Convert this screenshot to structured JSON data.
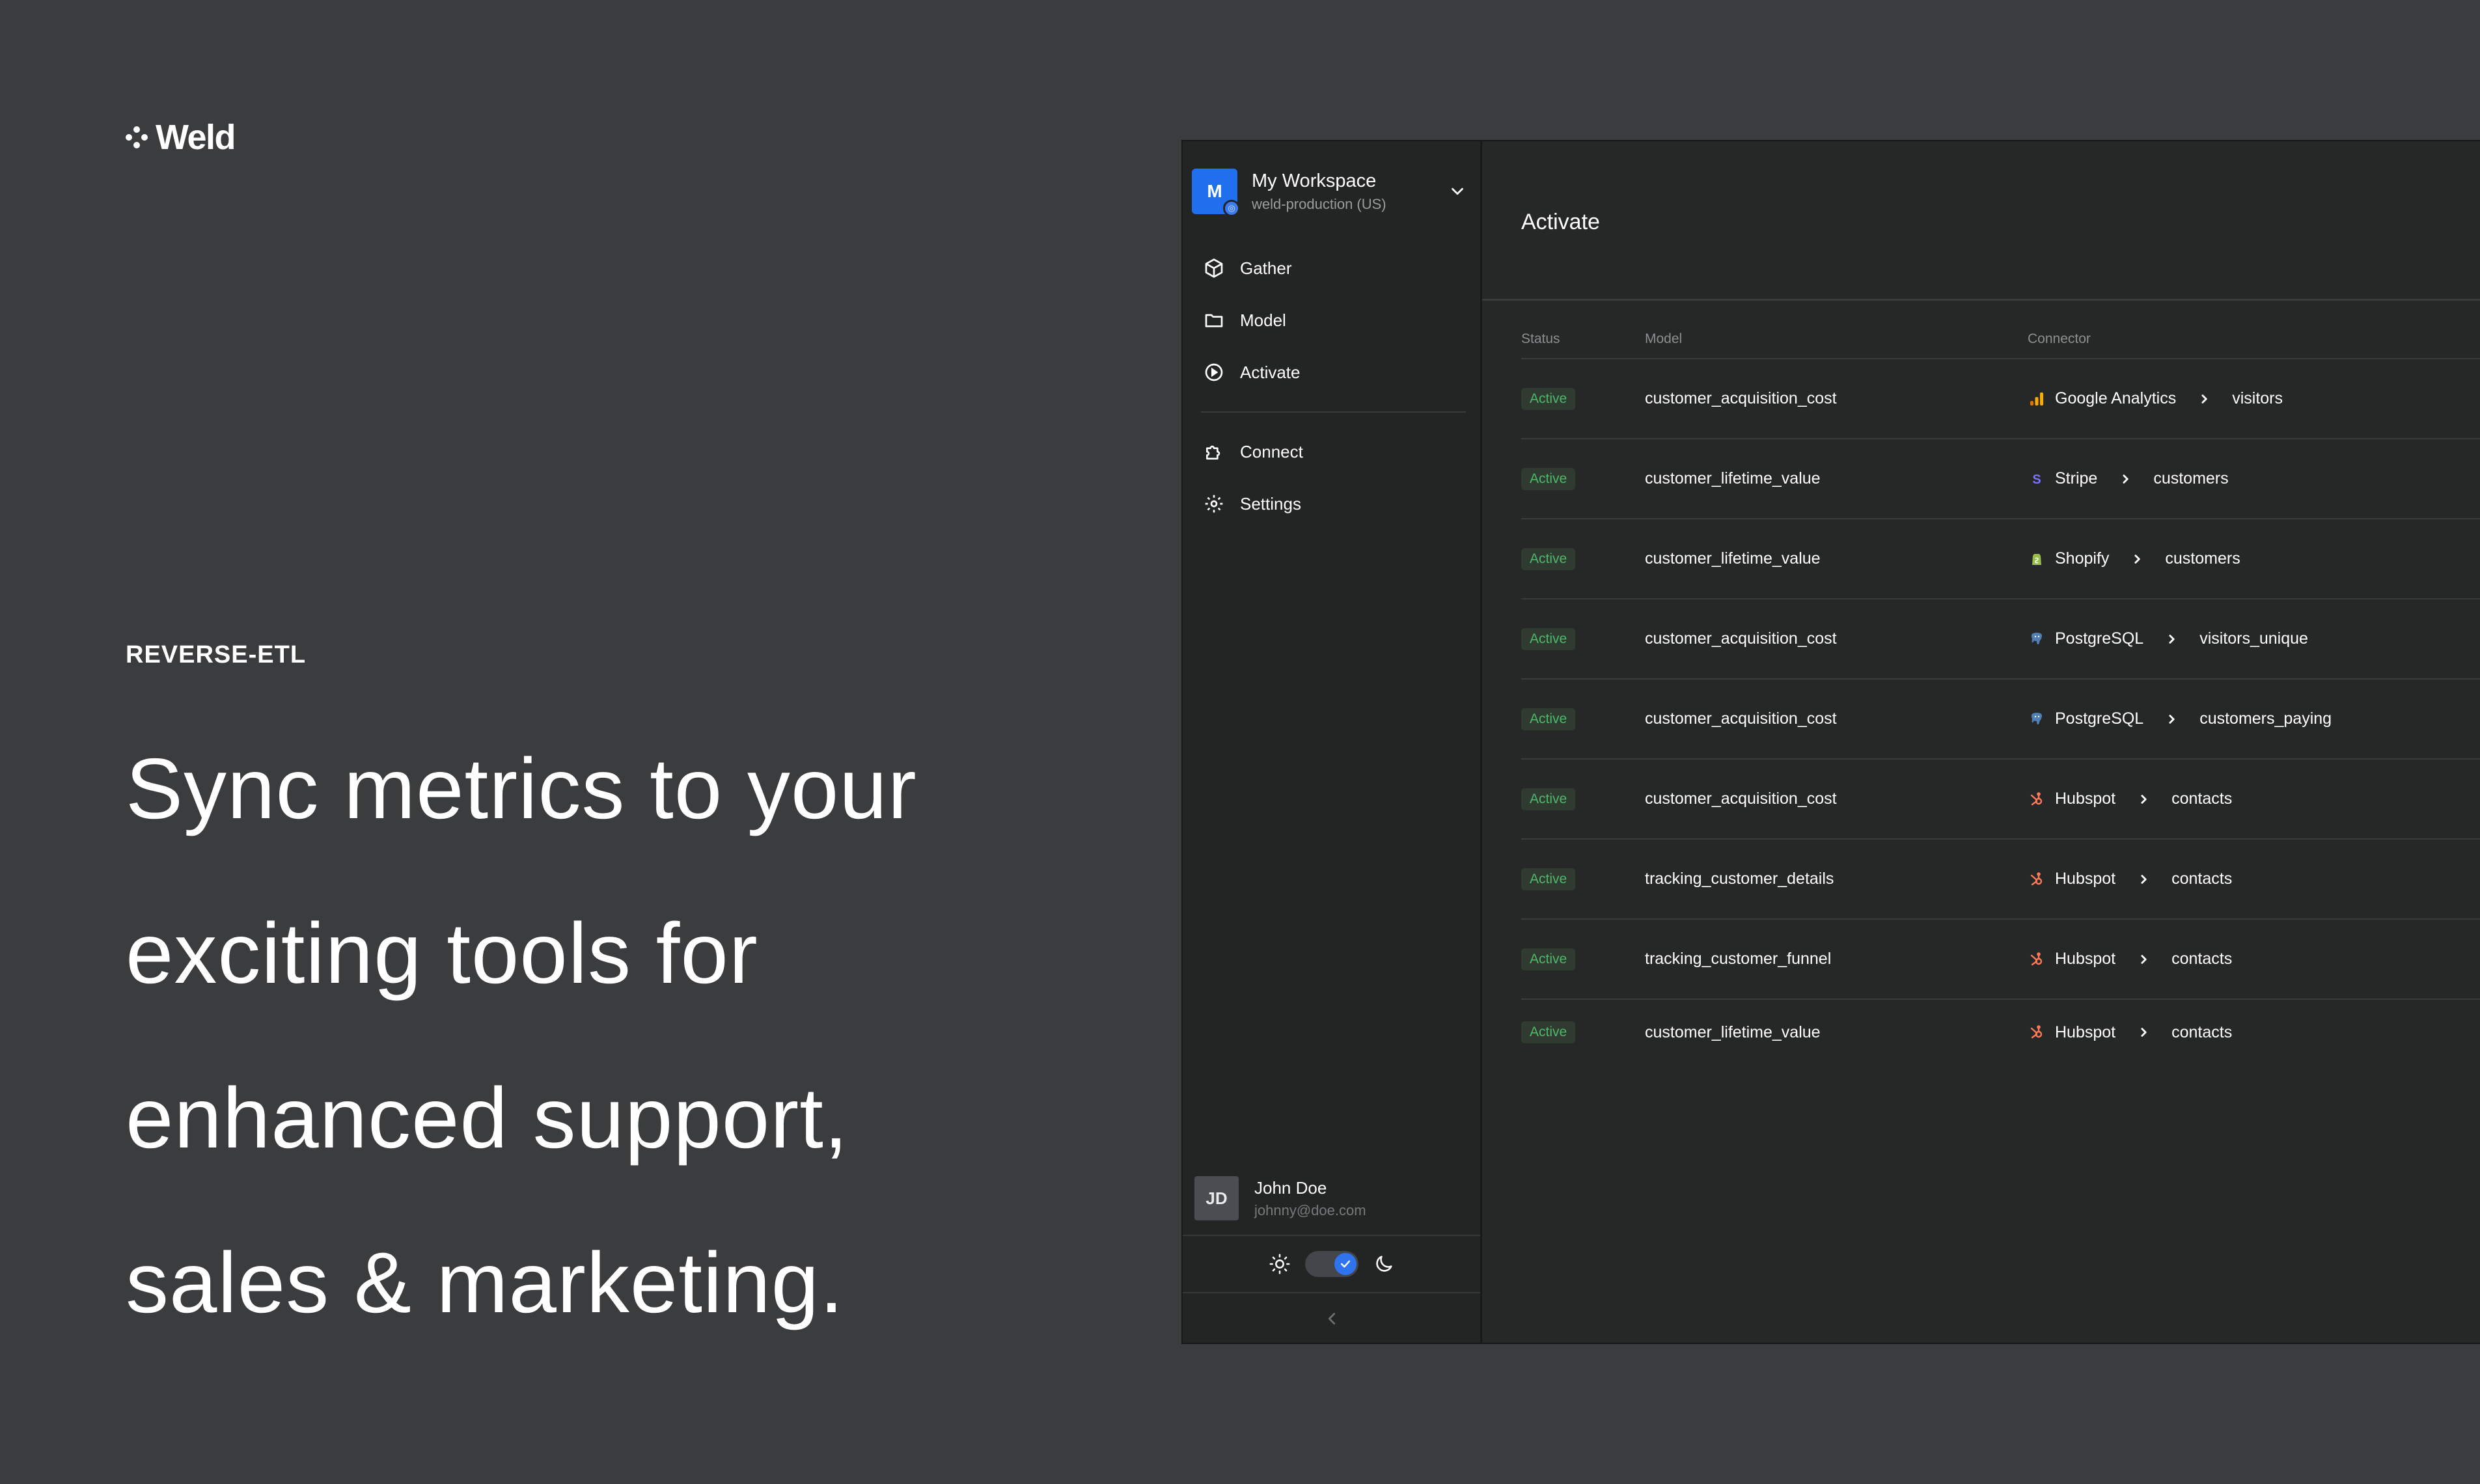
{
  "brand": {
    "name": "Weld"
  },
  "hero": {
    "eyebrow": "REVERSE-ETL",
    "headline_lines": [
      "Sync metrics to your",
      "exciting tools for",
      "enhanced support,",
      "sales & marketing."
    ]
  },
  "app": {
    "workspace": {
      "initial": "M",
      "name": "My Workspace",
      "subtitle": "weld-production (US)"
    },
    "nav": {
      "primary": [
        {
          "label": "Gather",
          "icon": "cube-icon"
        },
        {
          "label": "Model",
          "icon": "folder-icon"
        },
        {
          "label": "Activate",
          "icon": "play-circle-icon"
        }
      ],
      "secondary": [
        {
          "label": "Connect",
          "icon": "puzzle-icon"
        },
        {
          "label": "Settings",
          "icon": "gear-icon"
        }
      ]
    },
    "user": {
      "initials": "JD",
      "name": "John Doe",
      "email": "johnny@doe.com"
    },
    "theme": {
      "mode": "dark"
    },
    "main": {
      "title": "Activate",
      "columns": {
        "status": "Status",
        "model": "Model",
        "connector": "Connector"
      },
      "rows": [
        {
          "status": "Active",
          "model": "customer_acquisition_cost",
          "connector": "Google Analytics",
          "connector_icon": "google-analytics-icon",
          "target": "visitors"
        },
        {
          "status": "Active",
          "model": "customer_lifetime_value",
          "connector": "Stripe",
          "connector_icon": "stripe-icon",
          "target": "customers"
        },
        {
          "status": "Active",
          "model": "customer_lifetime_value",
          "connector": "Shopify",
          "connector_icon": "shopify-icon",
          "target": "customers"
        },
        {
          "status": "Active",
          "model": "customer_acquisition_cost",
          "connector": "PostgreSQL",
          "connector_icon": "postgresql-icon",
          "target": "visitors_unique"
        },
        {
          "status": "Active",
          "model": "customer_acquisition_cost",
          "connector": "PostgreSQL",
          "connector_icon": "postgresql-icon",
          "target": "customers_paying"
        },
        {
          "status": "Active",
          "model": "customer_acquisition_cost",
          "connector": "Hubspot",
          "connector_icon": "hubspot-icon",
          "target": "contacts"
        },
        {
          "status": "Active",
          "model": "tracking_customer_details",
          "connector": "Hubspot",
          "connector_icon": "hubspot-icon",
          "target": "contacts"
        },
        {
          "status": "Active",
          "model": "tracking_customer_funnel",
          "connector": "Hubspot",
          "connector_icon": "hubspot-icon",
          "target": "contacts"
        },
        {
          "status": "Active",
          "model": "customer_lifetime_value",
          "connector": "Hubspot",
          "connector_icon": "hubspot-icon",
          "target": "contacts"
        }
      ]
    }
  },
  "colors": {
    "page_bg": "#3b3c3e",
    "app_bg": "#262727",
    "accent_blue": "#1f6fef",
    "status_green": "#4fb76a"
  }
}
